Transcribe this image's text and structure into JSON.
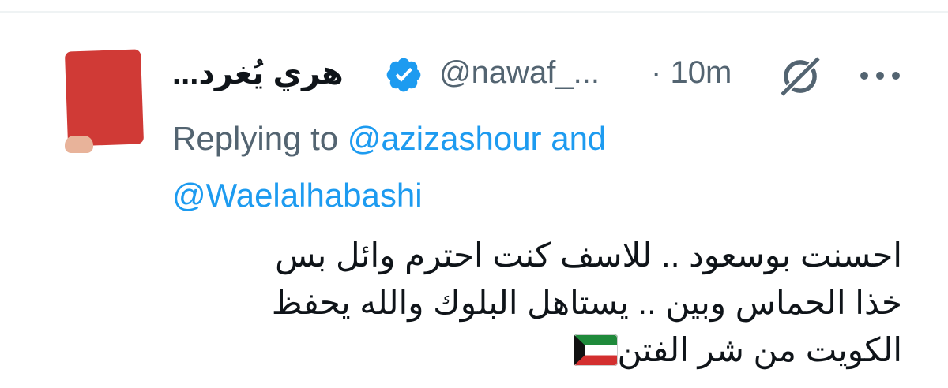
{
  "tweet": {
    "author": {
      "display_name": "هري يُغرد...",
      "handle": "@nawaf_...",
      "verified": true,
      "avatar": "red-card-avatar"
    },
    "time_separator": "·",
    "time": "10m",
    "reply": {
      "prefix": "Replying to",
      "mention_1": "@azizashour",
      "and_word": "and",
      "mention_2": "@Waelalhabashi"
    },
    "text_lines": [
      "احسنت بوسعود .. للاسف كنت احترم وائل بس",
      "خذا الحماس وبين .. يستاهل البلوك والله يحفظ",
      "الكويت من شر الفتن"
    ],
    "emoji": "kuwait-flag"
  },
  "icons": {
    "verified": "verified-badge-icon",
    "grok": "grok-icon",
    "more": "more-options-icon"
  },
  "colors": {
    "text_primary": "#0f1419",
    "text_secondary": "#536471",
    "link": "#1d9bf0",
    "verified": "#1d9bf0",
    "divider": "#eff3f4"
  }
}
